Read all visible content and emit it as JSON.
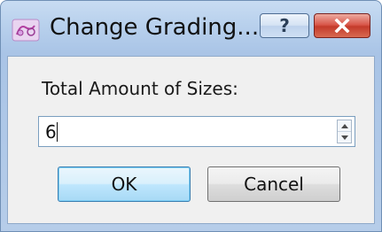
{
  "window": {
    "title": "Change Grading...",
    "help_symbol": "?",
    "app_icon": "grading-app-icon",
    "close_icon": "close-icon"
  },
  "form": {
    "label": "Total Amount of Sizes:",
    "sizes_value": "6"
  },
  "buttons": {
    "ok_label": "OK",
    "cancel_label": "Cancel"
  },
  "colors": {
    "title_bar": "#b9d1ed",
    "close_button": "#c33a2b",
    "dialog_background": "#f0f0f0",
    "default_button_highlight": "#bee6fd"
  }
}
